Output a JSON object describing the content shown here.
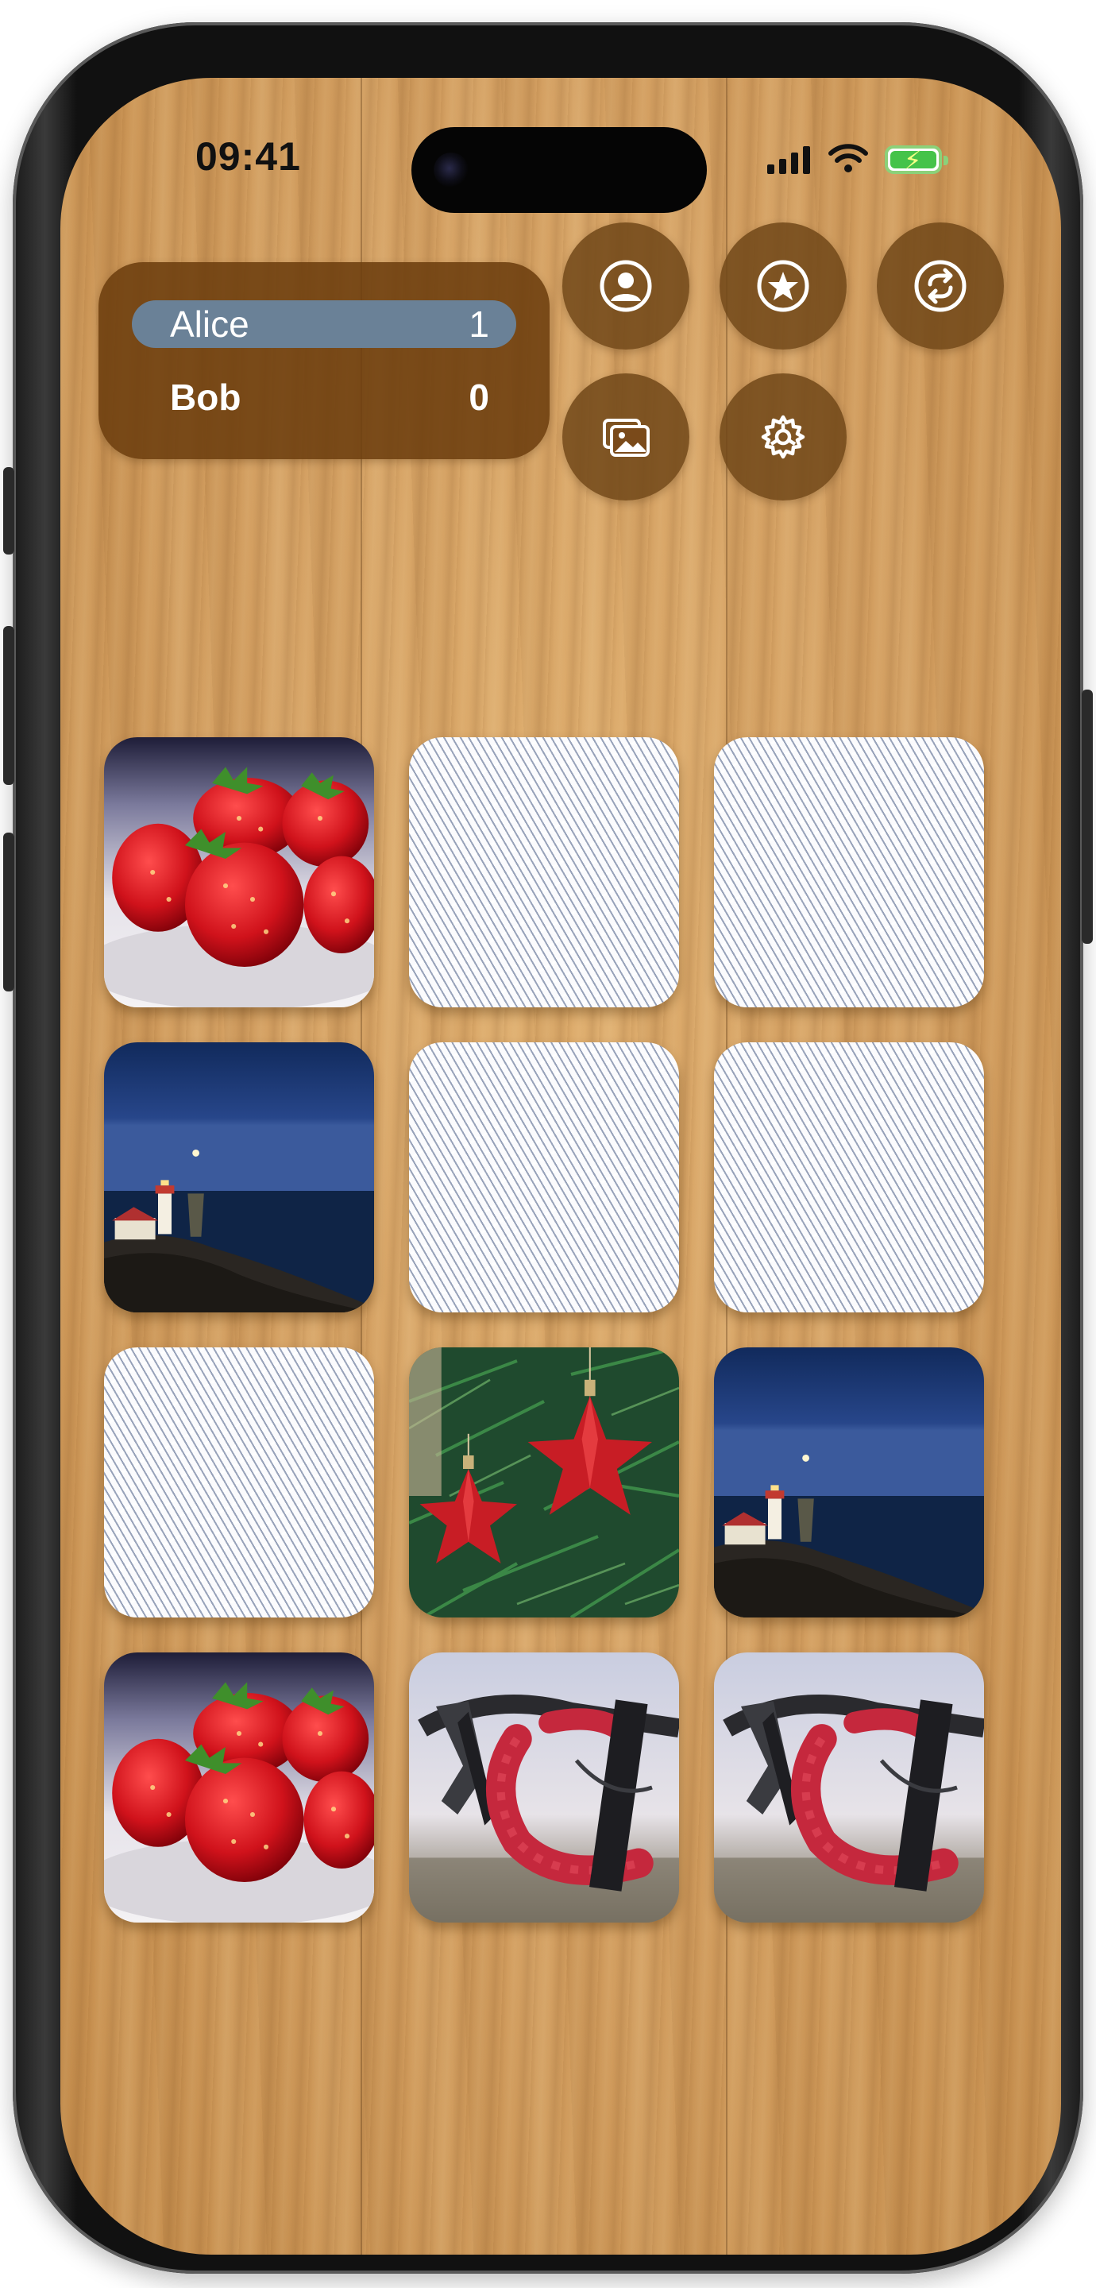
{
  "status_bar": {
    "time": "09:41"
  },
  "scoreboard": {
    "players": [
      {
        "name": "Alice",
        "score": "1",
        "active": true
      },
      {
        "name": "Bob",
        "score": "0",
        "active": false
      }
    ]
  },
  "toolbar": {
    "buttons": [
      {
        "icon": "person-icon"
      },
      {
        "icon": "star-icon"
      },
      {
        "icon": "swap-arrows-icon"
      },
      {
        "icon": "photos-icon"
      },
      {
        "icon": "gear-icon"
      }
    ]
  },
  "colors": {
    "panel_brown": "#6c3e0e",
    "active_row": "#6a8197",
    "battery_green": "#45c34a"
  },
  "board": {
    "columns": 3,
    "rows": 4,
    "cards": [
      {
        "state": "face-up",
        "image": "strawberries"
      },
      {
        "state": "face-down",
        "image": ""
      },
      {
        "state": "face-down",
        "image": ""
      },
      {
        "state": "face-up",
        "image": "lighthouse"
      },
      {
        "state": "face-down",
        "image": ""
      },
      {
        "state": "face-down",
        "image": ""
      },
      {
        "state": "face-down",
        "image": ""
      },
      {
        "state": "face-up",
        "image": "christmas-stars"
      },
      {
        "state": "face-up",
        "image": "lighthouse"
      },
      {
        "state": "face-up",
        "image": "strawberries"
      },
      {
        "state": "face-up",
        "image": "bicycle-handlebar"
      },
      {
        "state": "face-up",
        "image": "bicycle-handlebar"
      }
    ]
  }
}
